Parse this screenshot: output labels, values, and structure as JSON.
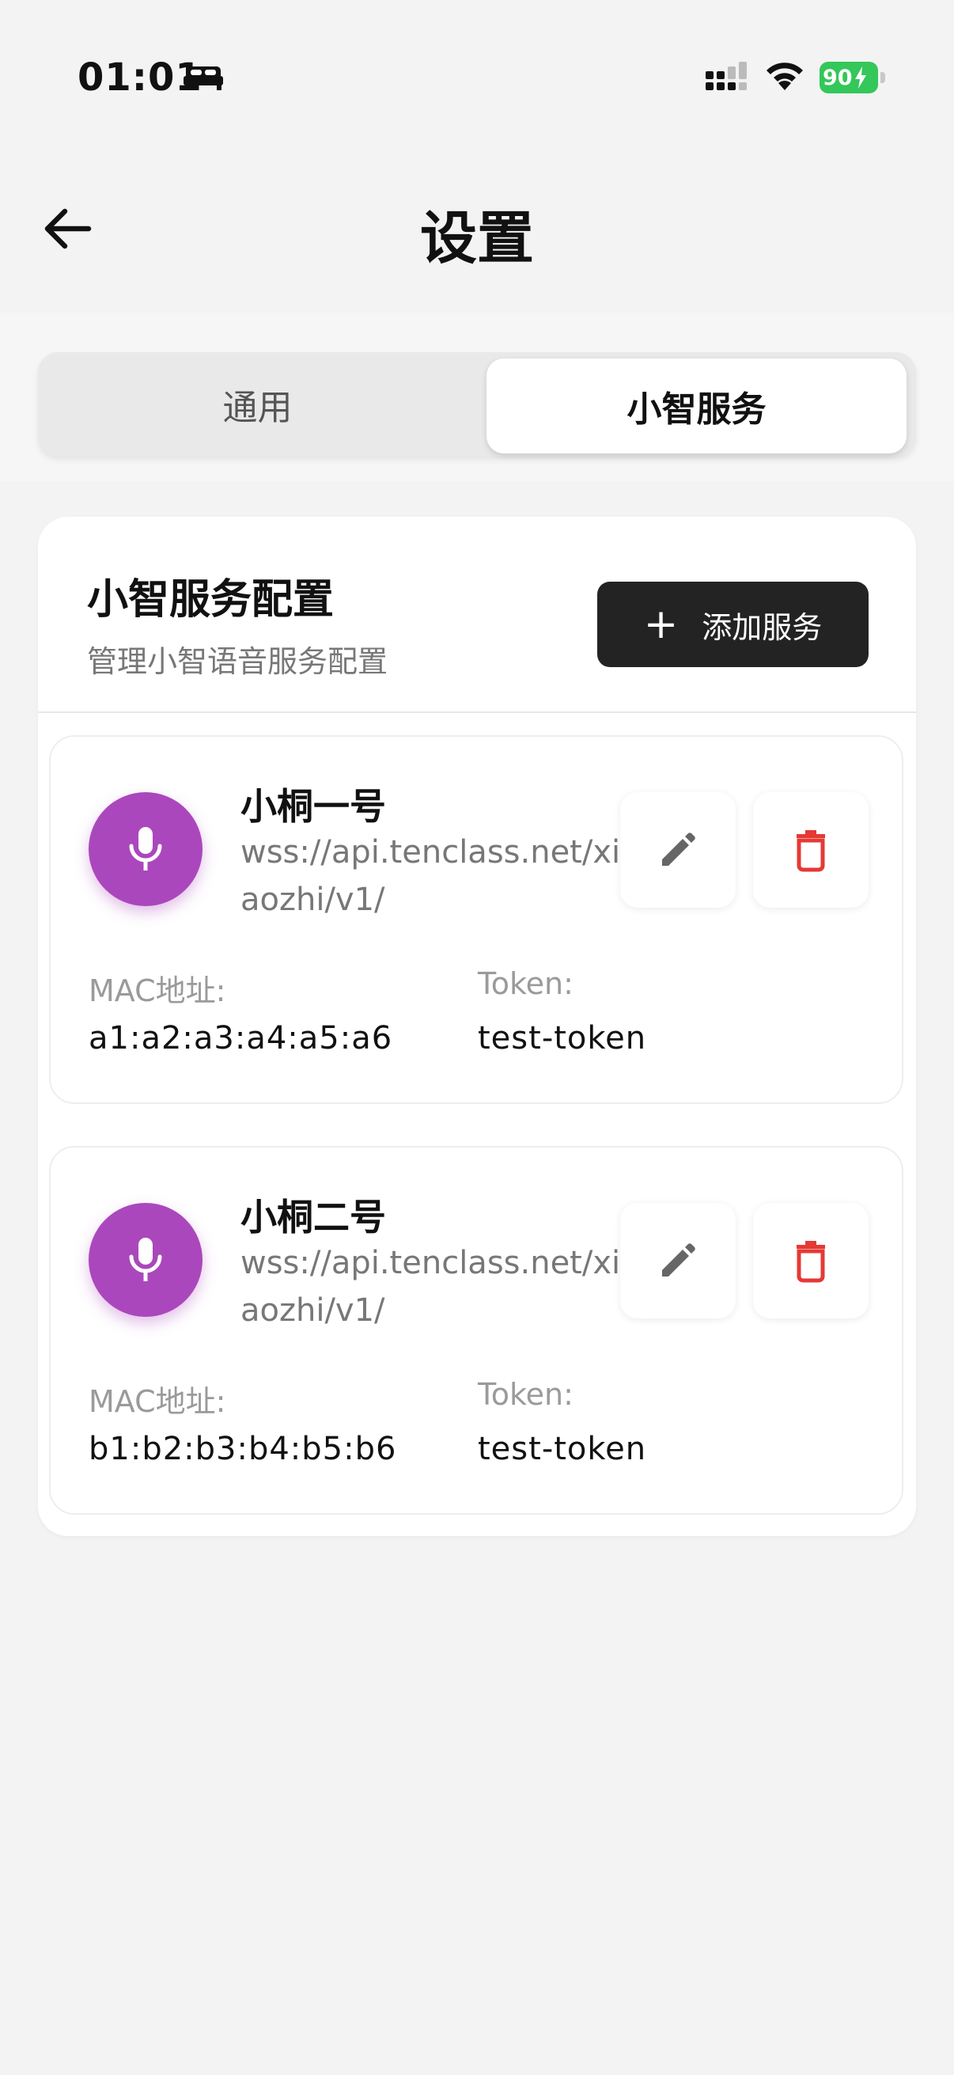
{
  "status_bar": {
    "time": "01:01",
    "battery": "90"
  },
  "header": {
    "title": "设置"
  },
  "tabs": [
    {
      "label": "通用",
      "selected": false
    },
    {
      "label": "小智服务",
      "selected": true
    }
  ],
  "config_card": {
    "title": "小智服务配置",
    "subtitle": "管理小智语音服务配置",
    "add_button_label": "添加服务"
  },
  "services": [
    {
      "name": "小桐一号",
      "url": "wss://api.tenclass.net/xiaozhi/v1/",
      "mac_label": "MAC地址:",
      "mac": "a1:a2:a3:a4:a5:a6",
      "token_label": "Token:",
      "token": "test-token"
    },
    {
      "name": "小桐二号",
      "url": "wss://api.tenclass.net/xiaozhi/v1/",
      "mac_label": "MAC地址:",
      "mac": "b1:b2:b3:b4:b5:b6",
      "token_label": "Token:",
      "token": "test-token"
    }
  ],
  "colors": {
    "avatar": "#ab47bc",
    "delete": "#e53935",
    "battery": "#34c759",
    "add_button": "#232323"
  },
  "icons": [
    "back-arrow-icon",
    "microphone-icon",
    "pencil-icon",
    "trash-icon",
    "plus-icon"
  ]
}
